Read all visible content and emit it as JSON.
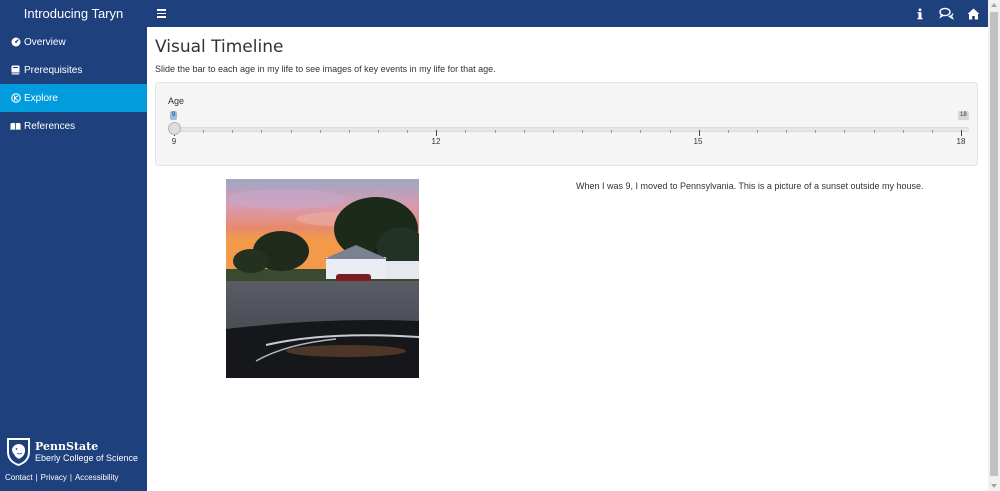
{
  "app": {
    "title": "Introducing Taryn"
  },
  "topbar": {
    "icons": [
      "info-icon",
      "comments-icon",
      "home-icon"
    ]
  },
  "sidebar": {
    "items": [
      {
        "label": "Overview",
        "icon": "dashboard-icon",
        "active": false
      },
      {
        "label": "Prerequisites",
        "icon": "book-icon",
        "active": false
      },
      {
        "label": "Explore",
        "icon": "wpexplorer-icon",
        "active": true
      },
      {
        "label": "References",
        "icon": "leanpub-icon",
        "active": false
      }
    ],
    "logo": {
      "title": "PennState",
      "subtitle": "Eberly College of Science"
    },
    "footer": {
      "contact": "Contact",
      "privacy": "Privacy",
      "accessibility": "Accessibility",
      "separator": "|"
    }
  },
  "main": {
    "title": "Visual Timeline",
    "description": "Slide the bar to each age in my life to see images of key events in my life for that age.",
    "slider": {
      "label": "Age",
      "min": 9,
      "max": 18,
      "value": 9,
      "value_label": "9",
      "max_label": "18",
      "tick_labels": [
        "9",
        "12",
        "15",
        "18"
      ]
    },
    "caption": "When I was 9, I moved to Pennsylvania. This is a picture of a sunset outside my house."
  },
  "colors": {
    "brand": "#1e407c",
    "active": "#009cde"
  }
}
